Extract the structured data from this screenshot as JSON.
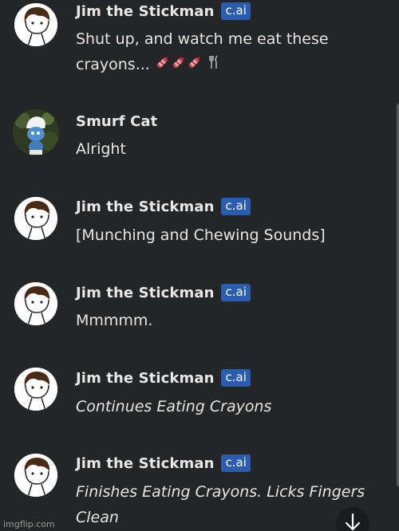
{
  "messages": [
    {
      "name": "Jim the Stickman",
      "badge": "c.ai",
      "line1": "Shut up, and watch me eat these",
      "line2": "crayons... ",
      "emojis": "🖍🖍🖍",
      "emoji_fork": "🍴"
    },
    {
      "name": "Smurf Cat",
      "text": "Alright"
    },
    {
      "name": "Jim the Stickman",
      "badge": "c.ai",
      "text": "[Munching and Chewing Sounds]"
    },
    {
      "name": "Jim the Stickman",
      "badge": "c.ai",
      "text": "Mmmmm."
    },
    {
      "name": "Jim the Stickman",
      "badge": "c.ai",
      "text": "Continues Eating Crayons"
    },
    {
      "name": "Jim the Stickman",
      "badge": "c.ai",
      "line1": "Finishes Eating Crayons. Licks Fingers",
      "line2": "Clean"
    }
  ],
  "icons": {
    "scroll_down": "arrow-down-icon",
    "crayon": "crayon-icon",
    "fork_knife": "fork-and-knife-icon"
  },
  "watermark": "imgflip.com",
  "colors": {
    "background": "#242526",
    "badge": "#2a5db0",
    "text": "#e6e6e6"
  }
}
